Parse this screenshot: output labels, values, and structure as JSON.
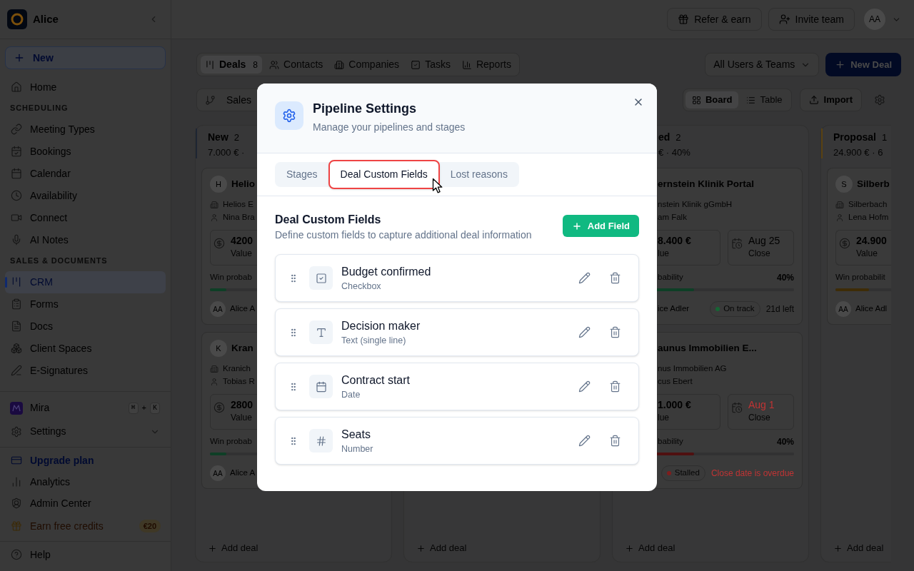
{
  "sidebar": {
    "workspace": "Alice",
    "new_button": "New",
    "sections": [
      {
        "items": [
          {
            "label": "Home",
            "selected": false
          }
        ]
      },
      {
        "heading": "SCHEDULING",
        "items": [
          {
            "label": "Meeting Types",
            "selected": false
          },
          {
            "label": "Bookings",
            "selected": false
          },
          {
            "label": "Calendar",
            "selected": false
          },
          {
            "label": "Availability",
            "selected": false
          },
          {
            "label": "Connect",
            "selected": false
          },
          {
            "label": "AI Notes",
            "selected": false
          }
        ]
      },
      {
        "heading": "SALES & DOCUMENTS",
        "items": [
          {
            "label": "CRM",
            "selected": true
          },
          {
            "label": "Forms",
            "selected": false
          },
          {
            "label": "Docs",
            "selected": false
          },
          {
            "label": "Client Spaces",
            "selected": false
          },
          {
            "label": "E-Signatures",
            "selected": false
          }
        ]
      }
    ],
    "assistant": {
      "label": "Mira",
      "shortcut": [
        "⌘",
        "K"
      ],
      "joiner": "+"
    },
    "settings": {
      "label": "Settings",
      "expanded": false
    },
    "footer": [
      {
        "label": "Upgrade plan",
        "kind": "upgrade"
      },
      {
        "label": "Analytics",
        "kind": "plain"
      },
      {
        "label": "Admin Center",
        "kind": "plain"
      },
      {
        "label": "Earn free credits",
        "kind": "promo",
        "badge": "€20"
      }
    ],
    "help": "Help"
  },
  "topbar": {
    "buttons": [
      "Refer & earn",
      "Invite team"
    ],
    "avatar": "AA"
  },
  "toolbar": {
    "tabs": [
      {
        "label": "Deals",
        "count": "8",
        "selected": true
      },
      {
        "label": "Contacts",
        "selected": false
      },
      {
        "label": "Companies",
        "selected": false
      },
      {
        "label": "Tasks",
        "selected": false
      },
      {
        "label": "Reports",
        "selected": false
      }
    ],
    "owner_filter": "All Users & Teams",
    "new_deal": "New Deal",
    "pipeline": "Sales",
    "views": [
      {
        "label": "Board",
        "selected": true
      },
      {
        "label": "Table",
        "selected": false
      }
    ],
    "import": "Import"
  },
  "board": {
    "stages": [
      {
        "name": "New",
        "count": "2",
        "summary": "7.000 € ·",
        "color": "#1e2633",
        "deals": [
          {
            "initial": "H",
            "title": "Helio",
            "company": "Helios E",
            "contact": "Nina Bra",
            "value": "4200",
            "value_label": "Value",
            "probability_label": "Win probab",
            "level": 0.1,
            "color": "#0e3f26",
            "owner_initials": "AA",
            "owner": "Alice A"
          },
          {
            "initial": "K",
            "title": "Kran",
            "company": "Kranich",
            "contact": "Tobias R",
            "value": "2800",
            "value_label": "Value",
            "probability_label": "Win probab",
            "level": 0.1,
            "color": "#0e3f26",
            "owner_initials": "AA",
            "owner": "Alice A"
          }
        ],
        "add_label": "Add deal"
      },
      {
        "add_label": "Add deal"
      },
      {
        "name": "ed",
        "count": "2",
        "summary": "€ · 40%",
        "deals": [
          {
            "title": "ernstein Klinik Portal",
            "company": "nstein Klinik gGmbH",
            "contact": "am Falk",
            "value": "8.400 €",
            "value_label": "lue",
            "close": "Aug 25",
            "close_label": "Close",
            "overdue": false,
            "probability_label": "bability",
            "probability": "40%",
            "level": 0.4,
            "color": "#0e3f26",
            "owner": "ice Adler",
            "status": {
              "label": "On track",
              "color": "#166534"
            },
            "due": "21d left"
          },
          {
            "title": "aunus Immobilien E...",
            "company": "nus Immobilien AG",
            "contact": "cus Ebert",
            "value": "1.000 €",
            "value_label": "lue",
            "close": "Aug 1",
            "close_label": "Close",
            "overdue": true,
            "probability_label": "bability",
            "probability": "40%",
            "level": 0.4,
            "color": "#4f1010",
            "status": {
              "label": "Stalled",
              "color": "#7f1d1d"
            },
            "due": "Close date is overdue"
          }
        ],
        "add_label": "Add deal"
      },
      {
        "name": "Proposal",
        "count": "1",
        "summary": "24.900 € · 6",
        "color": "#5a4212",
        "deals": [
          {
            "initial": "S",
            "title": "Silberb",
            "company": "Silberbach",
            "contact": "Lena Hofm",
            "value": "24.900",
            "value_label": "Value",
            "probability_label": "Win probabilit",
            "level": 0.6,
            "color": "#3e2c07",
            "owner_initials": "AA",
            "owner": "Alice Adl"
          }
        ],
        "add_label": "Add deal"
      }
    ]
  },
  "dialog": {
    "title": "Pipeline Settings",
    "subtitle": "Manage your pipelines and stages",
    "tabs": [
      {
        "label": "Stages",
        "selected": false
      },
      {
        "label": "Deal Custom Fields",
        "selected": true
      },
      {
        "label": "Lost reasons",
        "selected": false
      }
    ],
    "section_title": "Deal Custom Fields",
    "section_description": "Define custom fields to capture additional deal information",
    "add_button": "Add Field",
    "fields": [
      {
        "name": "Budget confirmed",
        "type": "Checkbox",
        "kind": "checkbox"
      },
      {
        "name": "Decision maker",
        "type": "Text (single line)",
        "kind": "text"
      },
      {
        "name": "Contract start",
        "type": "Date",
        "kind": "date"
      },
      {
        "name": "Seats",
        "type": "Number",
        "kind": "number"
      }
    ]
  }
}
